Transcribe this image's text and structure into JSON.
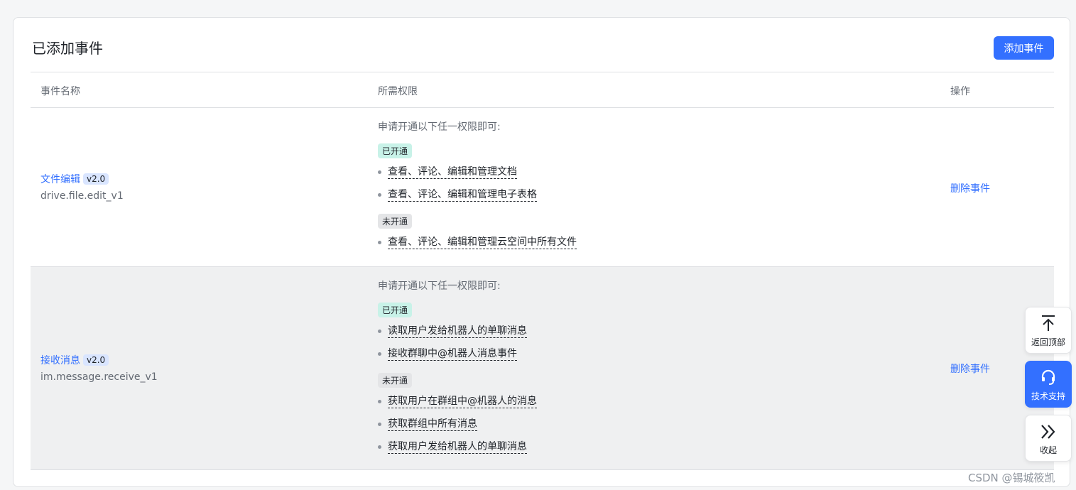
{
  "card": {
    "title": "已添加事件",
    "add_button": "添加事件"
  },
  "table": {
    "headers": [
      "事件名称",
      "所需权限",
      "操作"
    ],
    "rows": [
      {
        "name": "文件编辑",
        "version": "v2.0",
        "key": "drive.file.edit_v1",
        "intro": "申请开通以下任一权限即可:",
        "enabled_tag": "已开通",
        "enabled": [
          "查看、评论、编辑和管理文档",
          "查看、评论、编辑和管理电子表格"
        ],
        "disabled_tag": "未开通",
        "disabled": [
          "查看、评论、编辑和管理云空间中所有文件"
        ],
        "action": "删除事件"
      },
      {
        "name": "接收消息",
        "version": "v2.0",
        "key": "im.message.receive_v1",
        "intro": "申请开通以下任一权限即可:",
        "enabled_tag": "已开通",
        "enabled": [
          "读取用户发给机器人的单聊消息",
          "接收群聊中@机器人消息事件"
        ],
        "disabled_tag": "未开通",
        "disabled": [
          "获取用户在群组中@机器人的消息",
          "获取群组中所有消息",
          "获取用户发给机器人的单聊消息"
        ],
        "action": "删除事件"
      }
    ]
  },
  "float": {
    "top_label": "返回顶部",
    "support_label": "技术支持",
    "collapse_label": "收起"
  },
  "watermark": "CSDN @锡城筱凯",
  "colors": {
    "accent": "#3370ff",
    "enabled_tag_bg": "#c8f2e8",
    "disabled_tag_bg": "#e4e5e7"
  }
}
